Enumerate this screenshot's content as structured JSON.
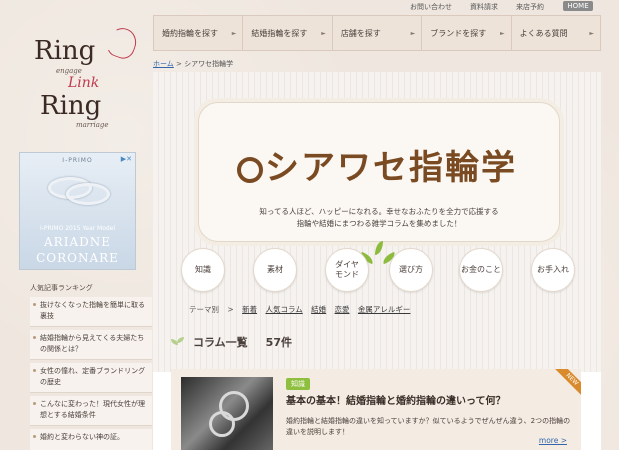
{
  "toplinks": [
    "お問い合わせ",
    "資料請求",
    "来店予約"
  ],
  "home_label": "HOME",
  "logo": {
    "line1": "Ring",
    "engage": "engage",
    "link": "Link",
    "line2": "Ring",
    "marriage": "marriage"
  },
  "ad": {
    "brand": "I-PRIMO",
    "year": "I-PRIMO 2015 Year Model",
    "name1": "ARIADNE",
    "name2": "CORONARE"
  },
  "sidebar": {
    "ranking_title": "人気記事ランキング",
    "items": [
      "抜けなくなった指輪を簡単に取る裏技",
      "結婚指輪から見えてくる夫婦たちの関係とは？",
      "女性の憧れ、定番ブランドリングの歴史",
      "こんなに変わった！現代女性が理想とする結婚条件",
      "婚約と変わらない神の証。"
    ]
  },
  "nav": [
    "婚約指輪を探す",
    "結婚指輪を探す",
    "店舗を探す",
    "ブランドを探す",
    "よくある質問"
  ],
  "breadcrumb": {
    "home": "ホーム",
    "sep": ">",
    "current": "シアワセ指輪学"
  },
  "hero": {
    "title": "シアワセ指輪学",
    "desc1": "知ってる人ほど、ハッピーになれる。幸せなおふたりを全力で応援する",
    "desc2": "指輪や結婚にまつわる雑学コラムを集めました！"
  },
  "categories": [
    "知識",
    "素材",
    "ダイヤ\nモンド",
    "選び方",
    "お金のこと",
    "お手入れ"
  ],
  "tags": {
    "label": "テーマ別",
    "sep": ">",
    "items": [
      "新着",
      "人気コラム",
      "結婚",
      "恋愛",
      "金属アレルギー"
    ]
  },
  "column": {
    "title": "コラム一覧",
    "count": "57件"
  },
  "card": {
    "badge": "知識",
    "title": "基本の基本！結婚指輪と婚約指輪の違いって何？",
    "text1": "婚約指輪と結婚指輪の違いを知っていますか？似ているようでぜんぜん違う、2つの指輪の",
    "text2": "違いを説明します！",
    "more": "more >",
    "new_label": "NEW"
  },
  "colors": {
    "accent": "#c0394b",
    "brown": "#7a4a22",
    "green": "#8fbf3f"
  }
}
